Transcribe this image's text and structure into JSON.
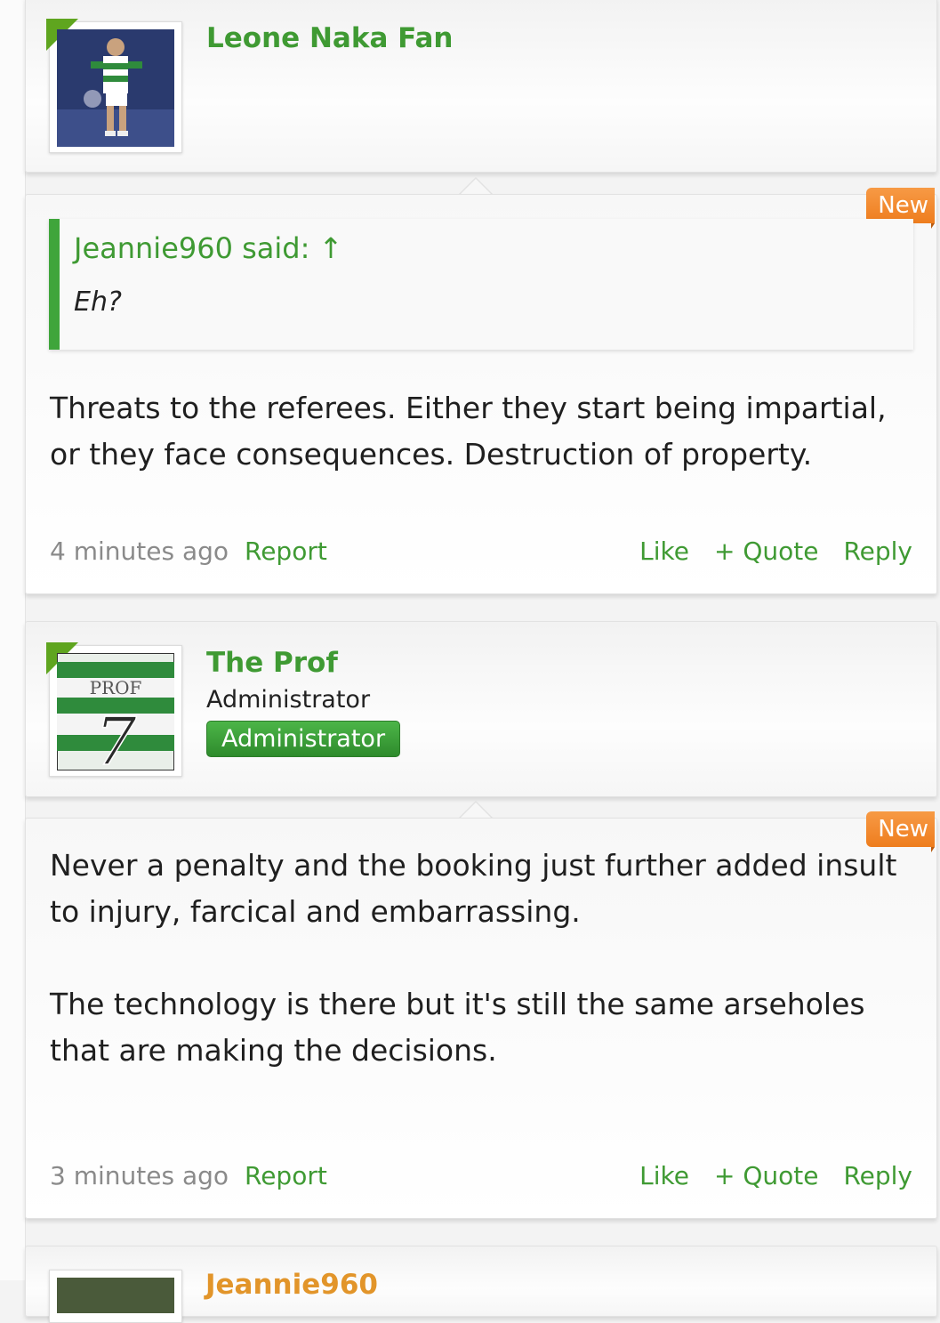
{
  "posts": [
    {
      "user": {
        "name": "Leone Naka Fan",
        "avatar_icon": "footballer-photo"
      },
      "badge_new": "New",
      "quote": {
        "author": "Jeannie960 said: ↑",
        "text": "Eh?"
      },
      "body": [
        "Threats to the referees. Either they start being impartial, or they face consequences. Destruction of property."
      ],
      "timestamp": "4 minutes ago",
      "report_label": "Report",
      "actions": {
        "like": "Like",
        "quote": "+ Quote",
        "reply": "Reply"
      }
    },
    {
      "user": {
        "name": "The Prof",
        "title": "Administrator",
        "role_badge": "Administrator",
        "avatar_icon": "prof-7-jersey",
        "avatar_text_top": "PROF",
        "avatar_text_number": "7"
      },
      "badge_new": "New",
      "body": [
        "Never a penalty and the booking just further added insult to injury, farcical and embarrassing.",
        "The technology is there but it's still the same arseholes that are making the decisions."
      ],
      "timestamp": "3 minutes ago",
      "report_label": "Report",
      "actions": {
        "like": "Like",
        "quote": "+ Quote",
        "reply": "Reply"
      }
    }
  ],
  "next_user_partial": {
    "name": "Jeannie960"
  },
  "colors": {
    "accent_green": "#3f9a33",
    "new_orange": "#f28a2e",
    "muted": "#8a8a8a"
  }
}
